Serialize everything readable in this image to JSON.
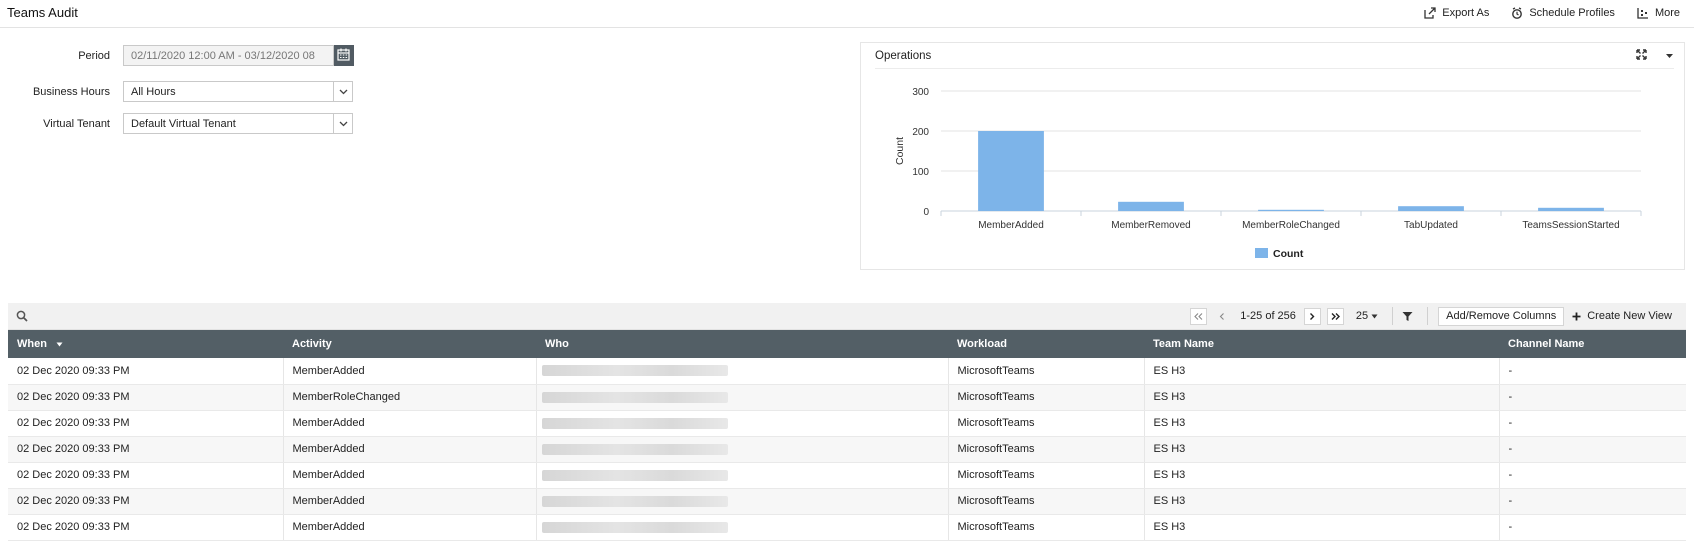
{
  "header": {
    "title": "Teams Audit",
    "actions": [
      {
        "label": "Export As",
        "icon": "export-icon"
      },
      {
        "label": "Schedule Profiles",
        "icon": "schedule-icon"
      },
      {
        "label": "More",
        "icon": "more-icon"
      }
    ]
  },
  "filters": {
    "period_label": "Period",
    "period_value": "02/11/2020 12:00 AM - 03/12/2020 08",
    "business_hours_label": "Business Hours",
    "business_hours_value": "All Hours",
    "virtual_tenant_label": "Virtual Tenant",
    "virtual_tenant_value": "Default Virtual Tenant"
  },
  "chart_panel": {
    "title": "Operations"
  },
  "chart_data": {
    "type": "bar",
    "title": "Operations",
    "ylabel": "Count",
    "xlabel": "",
    "categories": [
      "MemberAdded",
      "MemberRemoved",
      "MemberRoleChanged",
      "TabUpdated",
      "TeamsSessionStarted"
    ],
    "series": [
      {
        "name": "Count",
        "values": [
          200,
          23,
          3,
          12,
          8
        ]
      }
    ],
    "ylim": [
      0,
      300
    ],
    "yticks": [
      0,
      100,
      200,
      300
    ],
    "grid": true,
    "legend": "bottom",
    "color": "#7db4e9"
  },
  "grid": {
    "pager": {
      "info": "1-25 of 256",
      "page_size": "25",
      "add_remove_label": "Add/Remove Columns",
      "create_view_label": "Create New View"
    },
    "columns": [
      "When",
      "Activity",
      "Who",
      "Workload",
      "Team Name",
      "Channel Name"
    ],
    "rows": [
      {
        "when": "02 Dec 2020 09:33 PM",
        "activity": "MemberAdded",
        "workload": "MicrosoftTeams",
        "team": "ES H3",
        "channel": "-"
      },
      {
        "when": "02 Dec 2020 09:33 PM",
        "activity": "MemberRoleChanged",
        "workload": "MicrosoftTeams",
        "team": "ES H3",
        "channel": "-"
      },
      {
        "when": "02 Dec 2020 09:33 PM",
        "activity": "MemberAdded",
        "workload": "MicrosoftTeams",
        "team": "ES H3",
        "channel": "-"
      },
      {
        "when": "02 Dec 2020 09:33 PM",
        "activity": "MemberAdded",
        "workload": "MicrosoftTeams",
        "team": "ES H3",
        "channel": "-"
      },
      {
        "when": "02 Dec 2020 09:33 PM",
        "activity": "MemberAdded",
        "workload": "MicrosoftTeams",
        "team": "ES H3",
        "channel": "-"
      },
      {
        "when": "02 Dec 2020 09:33 PM",
        "activity": "MemberAdded",
        "workload": "MicrosoftTeams",
        "team": "ES H3",
        "channel": "-"
      },
      {
        "when": "02 Dec 2020 09:33 PM",
        "activity": "MemberAdded",
        "workload": "MicrosoftTeams",
        "team": "ES H3",
        "channel": "-"
      }
    ]
  }
}
